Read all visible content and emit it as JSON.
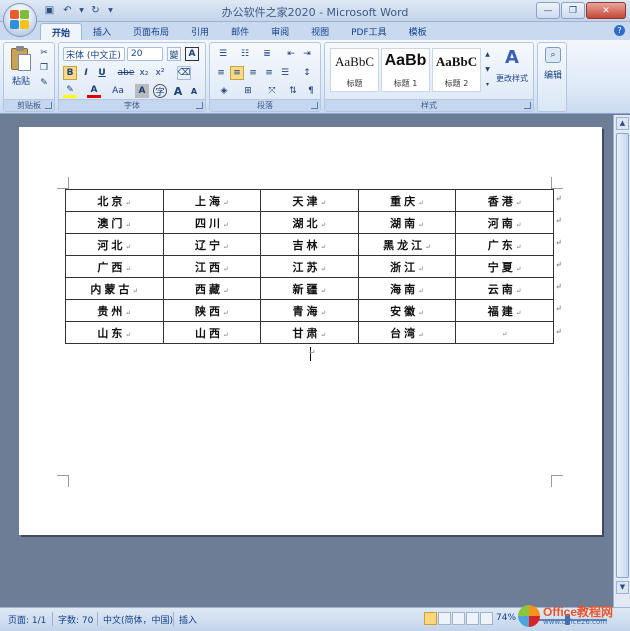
{
  "window": {
    "title": "办公软件之家2020 - Microsoft Word"
  },
  "ribbon_tabs": [
    "开始",
    "插入",
    "页面布局",
    "引用",
    "邮件",
    "审阅",
    "视图",
    "PDF工具",
    "模板"
  ],
  "ribbon": {
    "clipboard": {
      "paste_label": "粘贴",
      "group_label": "剪贴板"
    },
    "font": {
      "font_name": "宋体 (中文正)",
      "font_size": "20",
      "group_label": "字体",
      "bold": "B",
      "italic": "I",
      "underline": "U",
      "strike": "abe",
      "sub": "x₂",
      "sup": "x²",
      "clear_format": "Aa",
      "grow": "A",
      "shrink": "A"
    },
    "paragraph": {
      "group_label": "段落"
    },
    "styles": {
      "group_label": "样式",
      "items": [
        {
          "sample": "AaBbC",
          "name": "标题"
        },
        {
          "sample": "AaBb",
          "name": "标题 1"
        },
        {
          "sample": "AaBbC",
          "name": "标题 2"
        }
      ],
      "change_label": "更改样式"
    },
    "editing": {
      "label": "编辑"
    }
  },
  "table": {
    "rows": [
      [
        "北京",
        "上海",
        "天津",
        "重庆",
        "香港"
      ],
      [
        "澳门",
        "四川",
        "湖北",
        "湖南",
        "河南"
      ],
      [
        "河北",
        "辽宁",
        "吉林",
        "黑龙江",
        "广东"
      ],
      [
        "广西",
        "江西",
        "江苏",
        "浙江",
        "宁夏"
      ],
      [
        "内蒙古",
        "西藏",
        "新疆",
        "海南",
        "云南"
      ],
      [
        "贵州",
        "陕西",
        "青海",
        "安徽",
        "福建"
      ],
      [
        "山东",
        "山西",
        "甘肃",
        "台湾",
        ""
      ]
    ],
    "cell_mark": "↵",
    "row_mark": "↵"
  },
  "status": {
    "page": "页面: 1/1",
    "words": "字数: 70",
    "language": "中文(简体，中国)",
    "mode": "插入",
    "zoom": "74%"
  },
  "watermark": {
    "brand": "Office教程网",
    "url": "www.office26.com"
  }
}
